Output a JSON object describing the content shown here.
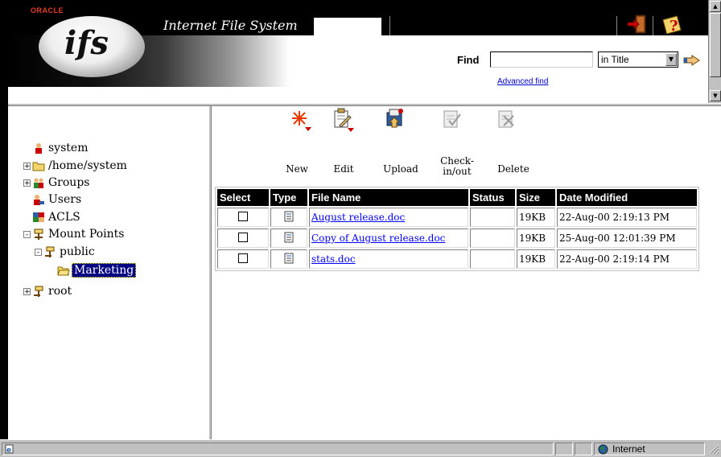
{
  "header": {
    "brand": "ORACLE",
    "logo_text": "ifs",
    "title": "Internet File System",
    "exit_icon": "exit-door-icon",
    "help_icon": "help-icon"
  },
  "find": {
    "label": "Find",
    "value": "",
    "scope": "in Title",
    "advanced_label": "Advanced find"
  },
  "tree": {
    "items": [
      {
        "label": "system",
        "icon": "user-icon",
        "expander": ""
      },
      {
        "label": "/home/system",
        "icon": "folder-icon",
        "expander": "+"
      },
      {
        "label": "Groups",
        "icon": "group-icon",
        "expander": "+"
      },
      {
        "label": "Users",
        "icon": "users-icon",
        "expander": ""
      },
      {
        "label": "ACLS",
        "icon": "acl-icon",
        "expander": ""
      },
      {
        "label": "Mount Points",
        "icon": "mount-points-icon",
        "expander": "-"
      },
      {
        "label": "public",
        "icon": "mount-point-icon",
        "expander": "-"
      },
      {
        "label": "Marketing",
        "icon": "open-folder-icon",
        "expander": "",
        "selected": true
      },
      {
        "label": "root",
        "icon": "mount-point-icon",
        "expander": "+"
      }
    ]
  },
  "toolbar": {
    "new_label": "New",
    "edit_label": "Edit",
    "upload_label": "Upload",
    "checkin_label_1": "Check-",
    "checkin_label_2": "in/out",
    "delete_label": "Delete"
  },
  "table": {
    "headers": [
      "Select",
      "Type",
      "File Name",
      "Status",
      "Size",
      "Date Modified"
    ],
    "rows": [
      {
        "name": "August release.doc",
        "status": "",
        "size": "19KB",
        "modified": "22-Aug-00 2:19:13 PM"
      },
      {
        "name": "Copy of August release.doc",
        "status": "",
        "size": "19KB",
        "modified": "25-Aug-00 12:01:39 PM"
      },
      {
        "name": "stats.doc",
        "status": "",
        "size": "19KB",
        "modified": "22-Aug-00 2:19:14 PM"
      }
    ]
  },
  "status_bar": {
    "zone": "Internet"
  },
  "colors": {
    "header_black": "#000000",
    "selection": "#000080",
    "link": "#0000ff",
    "chrome": "#c0c0c0"
  }
}
